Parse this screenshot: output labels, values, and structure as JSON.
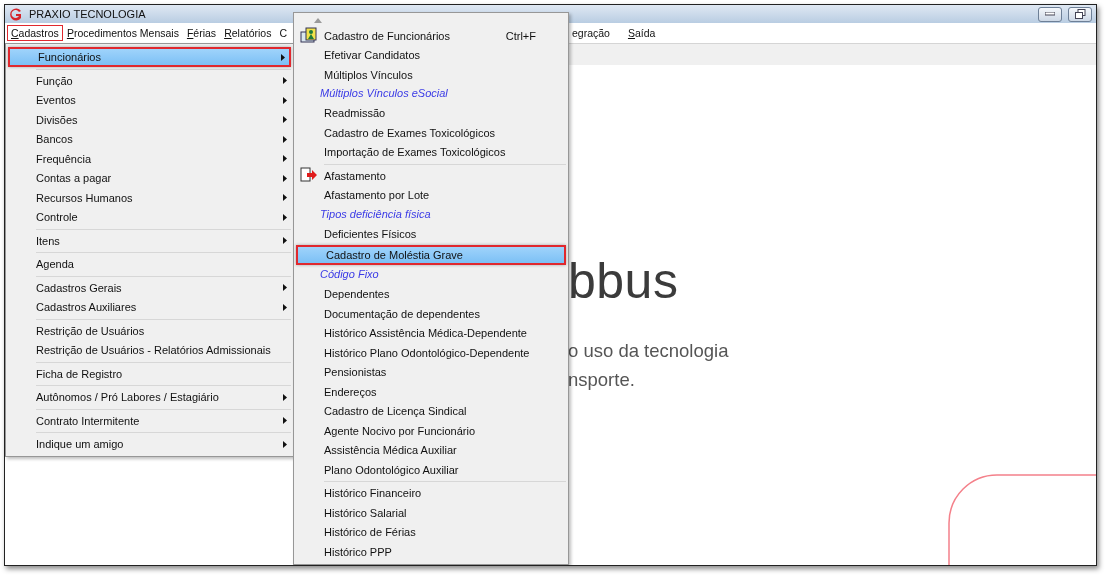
{
  "window": {
    "title": "PRAXIO TECNOLOGIA"
  },
  "menu_bar": [
    {
      "label": "Cadastros",
      "mnemonic": true,
      "selected": true
    },
    {
      "label": "Procedimentos Mensais",
      "mnemonic": true,
      "selected": false
    },
    {
      "label": "Férias",
      "mnemonic": true,
      "selected": false
    },
    {
      "label": "Relatórios",
      "mnemonic": true,
      "selected": false
    },
    {
      "label": "C"
    },
    {
      "label": "egração"
    },
    {
      "label": "Saída",
      "mnemonic": true
    }
  ],
  "background": {
    "headline": "bbus",
    "lines": [
      "o uso da tecnologia",
      "nsporte."
    ]
  },
  "cadastros_menu": {
    "groups": [
      {
        "items": [
          {
            "label": "Funcionários",
            "submenu": true,
            "selected": true
          }
        ]
      },
      {
        "items": [
          {
            "label": "Função",
            "submenu": true,
            "selected": false
          },
          {
            "label": "Eventos",
            "submenu": true,
            "selected": false
          },
          {
            "label": "Divisões",
            "submenu": true,
            "selected": false
          },
          {
            "label": "Bancos",
            "submenu": true,
            "selected": false
          },
          {
            "label": "Frequência",
            "submenu": true,
            "selected": false
          },
          {
            "label": "Contas a pagar",
            "submenu": true,
            "selected": false
          },
          {
            "label": "Recursos Humanos",
            "submenu": true,
            "selected": false
          },
          {
            "label": "Controle",
            "submenu": true,
            "selected": false
          }
        ]
      },
      {
        "items": [
          {
            "label": "Itens",
            "submenu": true,
            "selected": false
          }
        ]
      },
      {
        "items": [
          {
            "label": "Agenda",
            "submenu": false,
            "selected": false
          }
        ]
      },
      {
        "items": [
          {
            "label": "Cadastros Gerais",
            "submenu": true,
            "selected": false
          },
          {
            "label": "Cadastros Auxiliares",
            "submenu": true,
            "selected": false
          }
        ]
      },
      {
        "items": [
          {
            "label": "Restrição de Usuários",
            "submenu": false,
            "selected": false
          },
          {
            "label": "Restrição de Usuários - Relatórios Admissionais",
            "submenu": false,
            "selected": false
          }
        ]
      },
      {
        "items": [
          {
            "label": "Ficha de Registro",
            "submenu": false,
            "selected": false
          }
        ]
      },
      {
        "items": [
          {
            "label": "Autônomos / Pró Labores / Estagiário",
            "submenu": true,
            "selected": false
          }
        ]
      },
      {
        "items": [
          {
            "label": "Contrato Intermitente",
            "submenu": true,
            "selected": false
          }
        ]
      },
      {
        "items": [
          {
            "label": "Indique um amigo",
            "submenu": true,
            "selected": false
          }
        ]
      }
    ]
  },
  "funcionarios_menu": {
    "groups": [
      {
        "items": [
          {
            "kind": "icon-item",
            "label": "Cadastro de Funcionários",
            "shortcut": "Ctrl+F",
            "selected": false
          },
          {
            "kind": "item",
            "label": "Efetivar Candidatos",
            "selected": false
          },
          {
            "kind": "item",
            "label": "Múltiplos Vínculos",
            "selected": false
          },
          {
            "kind": "header",
            "label": "Múltiplos Vínculos eSocial"
          },
          {
            "kind": "item",
            "label": "Readmissão",
            "selected": false
          },
          {
            "kind": "item",
            "label": "Cadastro de Exames Toxicológicos",
            "selected": false
          },
          {
            "kind": "item",
            "label": "Importação de Exames Toxicológicos",
            "selected": false
          }
        ]
      },
      {
        "items": [
          {
            "kind": "icon-item",
            "label": "Afastamento",
            "selected": false
          },
          {
            "kind": "item",
            "label": "Afastamento por Lote",
            "selected": false
          },
          {
            "kind": "header",
            "label": "Tipos deficiência física"
          },
          {
            "kind": "item",
            "label": "Deficientes Físicos",
            "selected": false
          },
          {
            "kind": "item",
            "label": "Cadastro de Moléstia Grave",
            "selected": true
          },
          {
            "kind": "header",
            "label": "Código Fixo"
          },
          {
            "kind": "item",
            "label": "Dependentes",
            "selected": false
          },
          {
            "kind": "item",
            "label": "Documentação de dependentes",
            "selected": false
          },
          {
            "kind": "item",
            "label": "Histórico Assistência Médica-Dependente",
            "selected": false
          },
          {
            "kind": "item",
            "label": "Histórico Plano Odontológico-Dependente",
            "selected": false
          },
          {
            "kind": "item",
            "label": "Pensionistas",
            "selected": false
          },
          {
            "kind": "item",
            "label": "Endereços",
            "selected": false
          },
          {
            "kind": "item",
            "label": "Cadastro de Licença Sindical",
            "selected": false
          },
          {
            "kind": "item",
            "label": "Agente Nocivo por Funcionário",
            "selected": false
          },
          {
            "kind": "item",
            "label": "Assistência Médica Auxiliar",
            "selected": false
          },
          {
            "kind": "item",
            "label": "Plano Odontológico Auxiliar",
            "selected": false
          }
        ]
      },
      {
        "items": [
          {
            "kind": "item",
            "label": "Histórico Financeiro",
            "selected": false
          },
          {
            "kind": "item",
            "label": "Histórico Salarial",
            "selected": false
          },
          {
            "kind": "item",
            "label": "Histórico de Férias",
            "selected": false
          },
          {
            "kind": "item",
            "label": "Histórico PPP",
            "selected": false
          }
        ]
      }
    ]
  }
}
